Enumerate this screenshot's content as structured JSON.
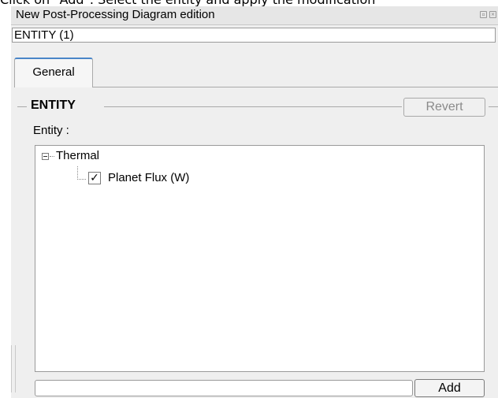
{
  "top_caption": "Click on \"Add\". Select the entity and apply the modification",
  "window": {
    "title": "New Post-Processing Diagram edition"
  },
  "entity_field": {
    "value": "ENTITY (1)"
  },
  "tabs": [
    {
      "label": "General"
    }
  ],
  "group": {
    "title": "ENTITY",
    "revert_label": "Revert"
  },
  "entity_label": "Entity :",
  "tree": {
    "root": {
      "label": "Thermal",
      "expanded": true
    },
    "children": [
      {
        "label": "Planet Flux (W)",
        "checked": true
      }
    ]
  },
  "add_row": {
    "input_value": "",
    "add_label": "Add"
  }
}
